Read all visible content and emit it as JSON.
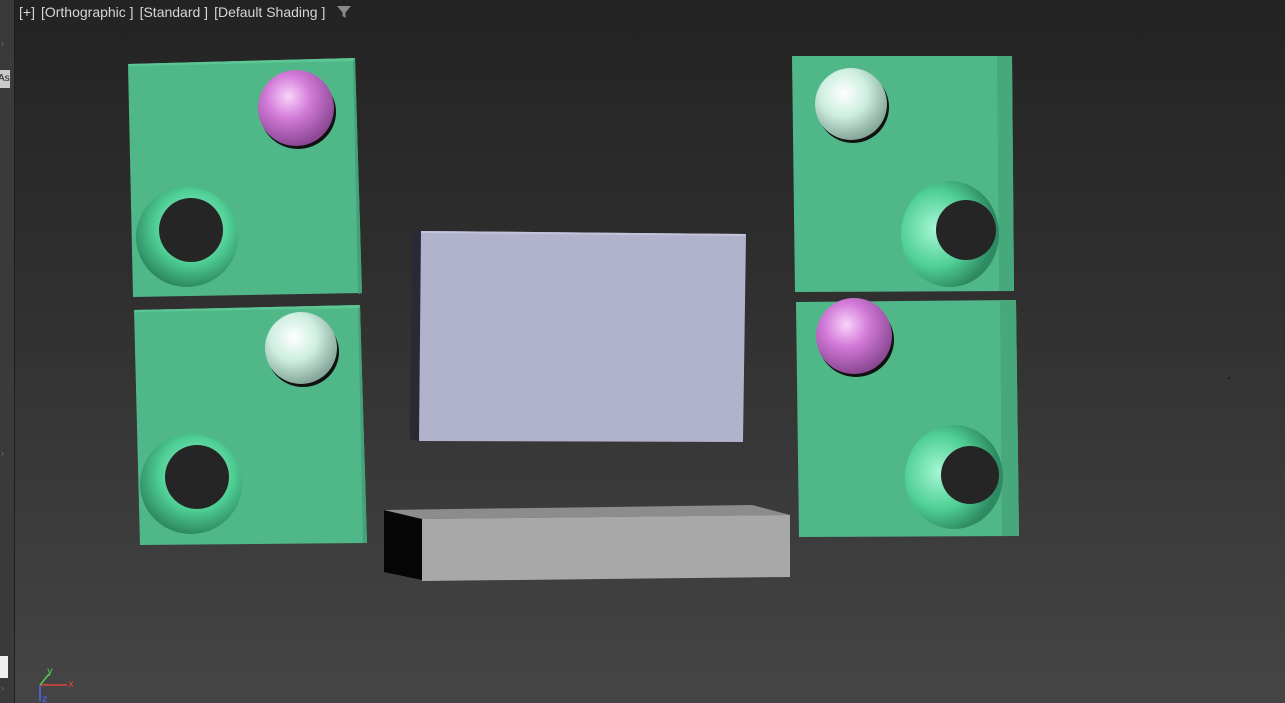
{
  "viewport": {
    "labels": {
      "plus": "[+]",
      "view": "[Orthographic ]",
      "mode": "[Standard ]",
      "shading": "[Default Shading ]"
    },
    "filter_icon": "filter-funnel-icon"
  },
  "left_strip": {
    "tab_text": "As"
  },
  "axis_gizmo": {
    "x_label": "x",
    "y_label": "y",
    "z_label": "z",
    "x_color": "#e0423a",
    "y_color": "#4fcf4f",
    "z_color": "#4a6cff"
  },
  "colors": {
    "panel_green": "#50b888",
    "sphere_pink": "#d27ad8",
    "sphere_mint": "#cdeee0",
    "screen_lavender": "#b1b2cb",
    "bar_gray": "#a8a8a8"
  }
}
